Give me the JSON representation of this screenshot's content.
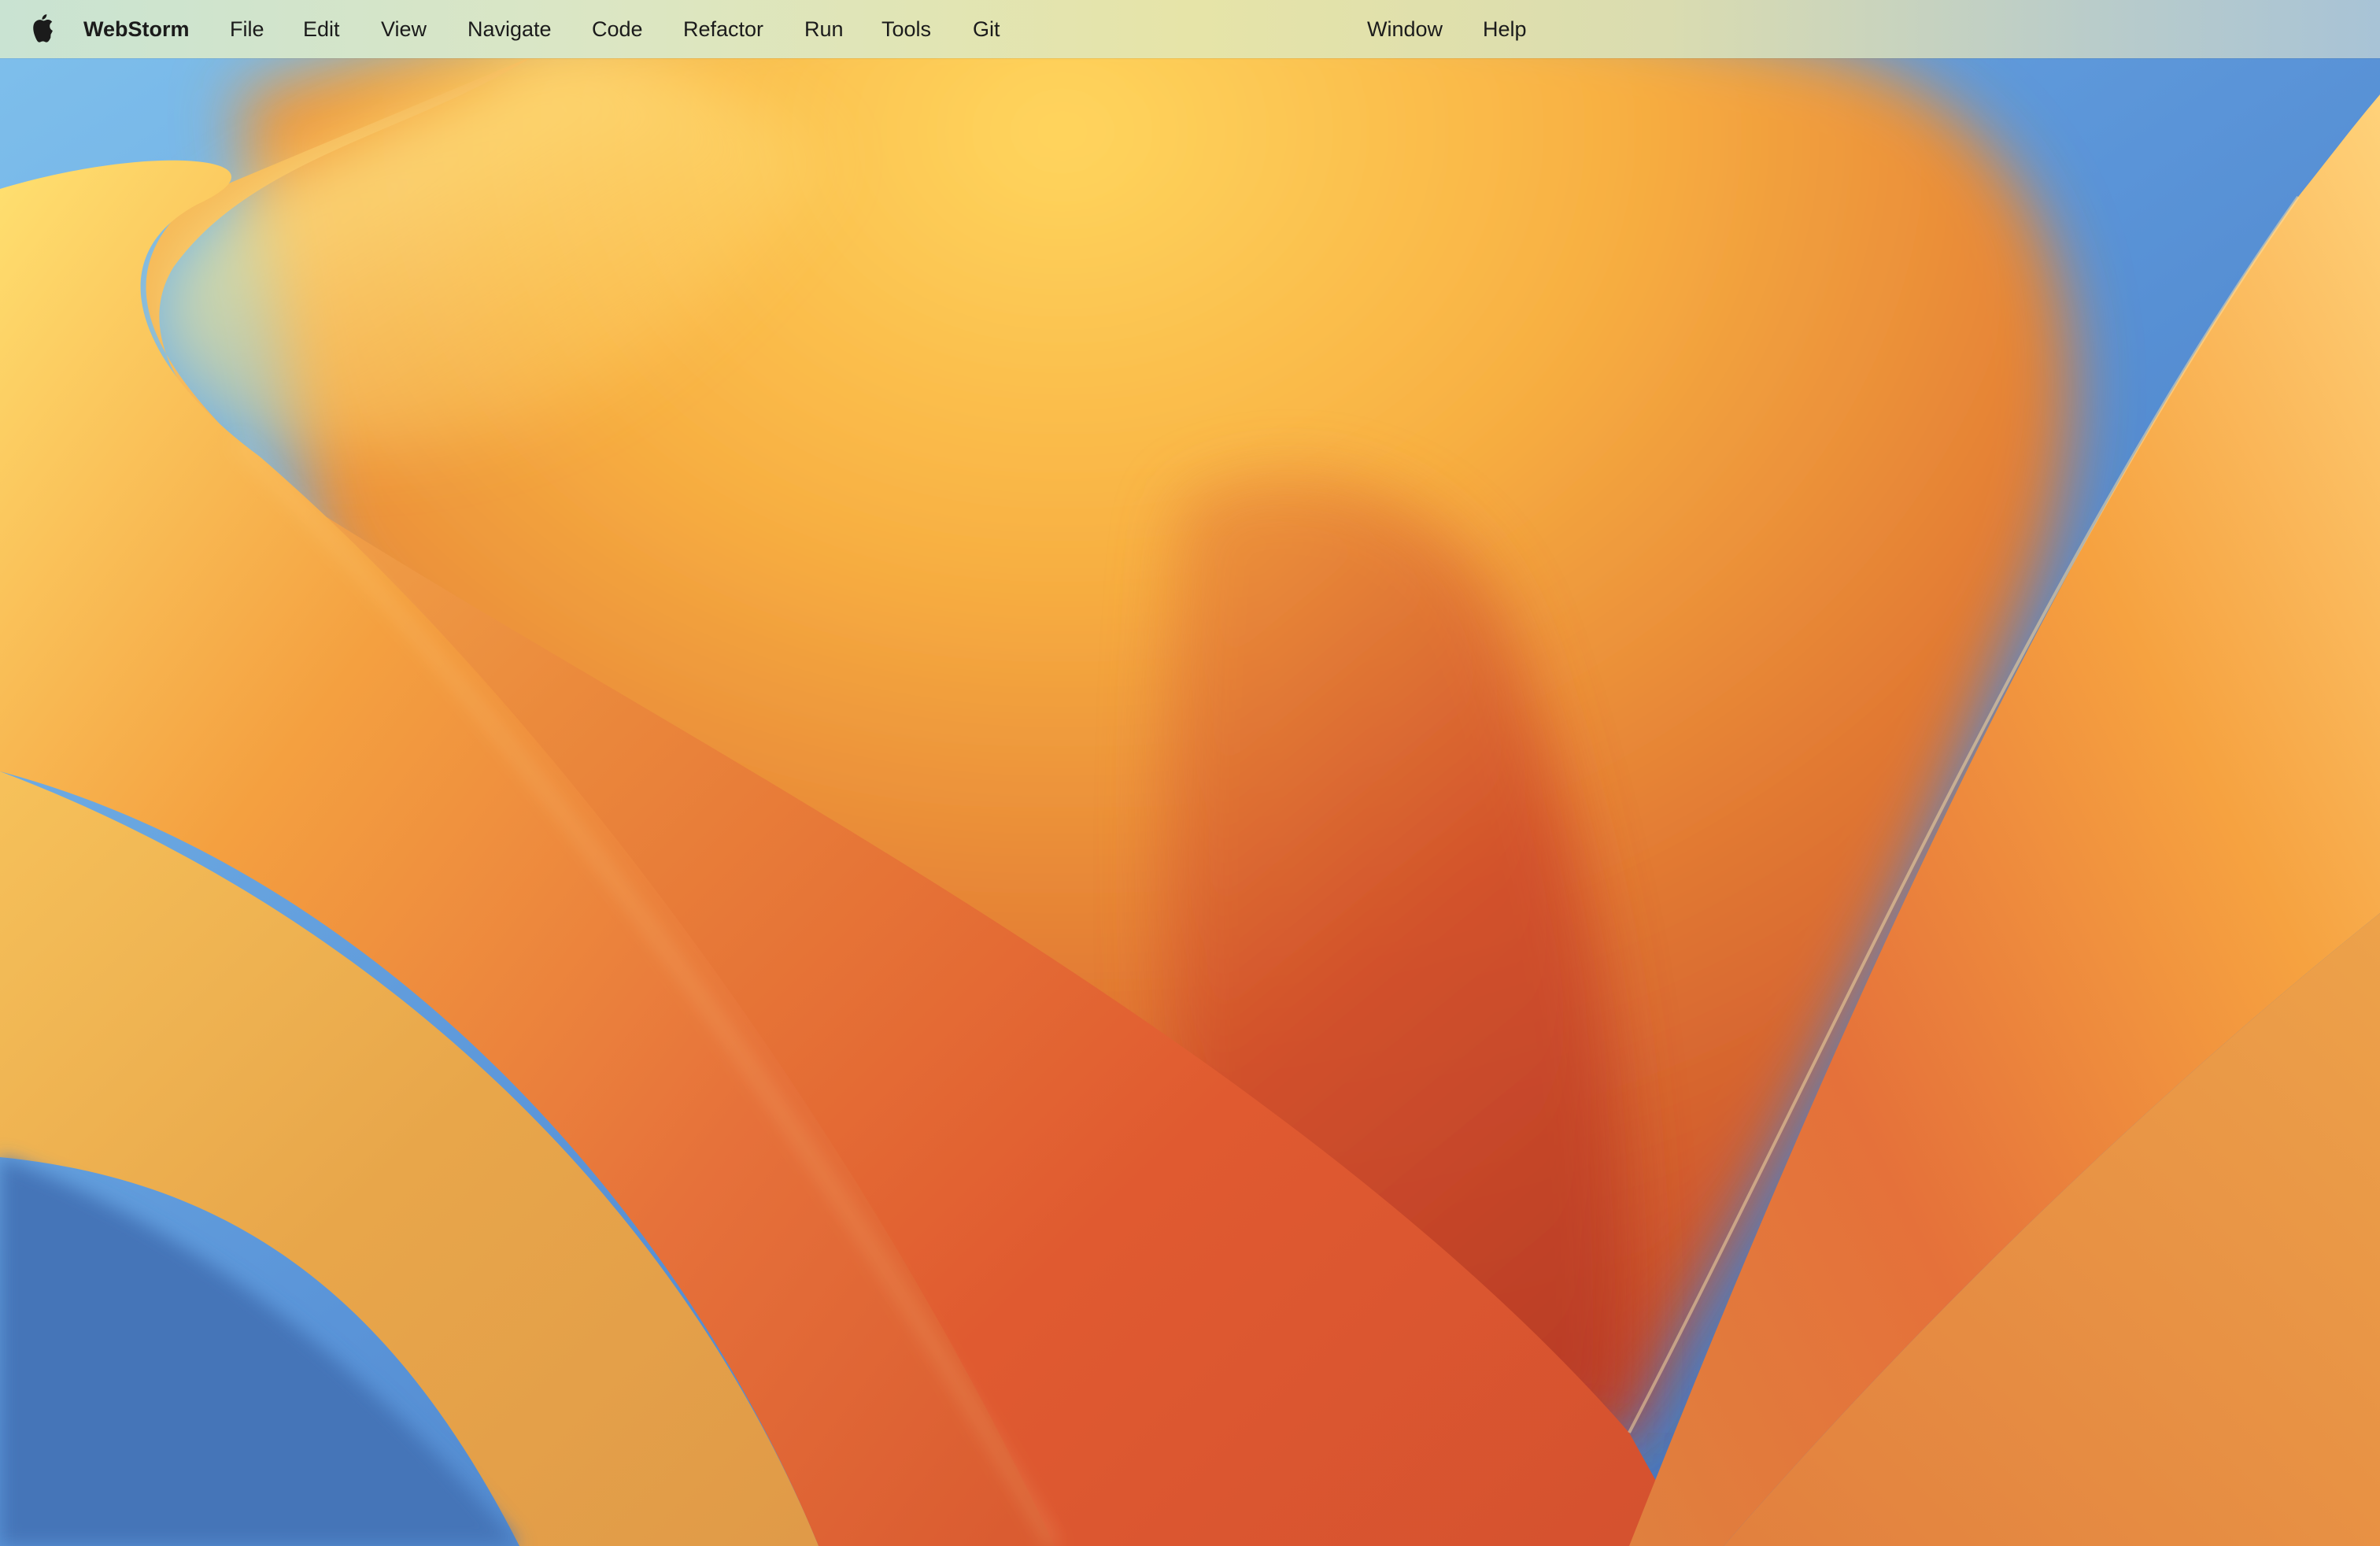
{
  "menubar": {
    "apple_icon": "apple-icon",
    "app_name": "WebStorm",
    "items": [
      {
        "id": "file",
        "label": "File"
      },
      {
        "id": "edit",
        "label": "Edit"
      },
      {
        "id": "view",
        "label": "View"
      },
      {
        "id": "navigate",
        "label": "Navigate"
      },
      {
        "id": "code",
        "label": "Code"
      },
      {
        "id": "refactor",
        "label": "Refactor"
      },
      {
        "id": "run",
        "label": "Run"
      },
      {
        "id": "tools",
        "label": "Tools"
      },
      {
        "id": "git",
        "label": "Git"
      },
      {
        "id": "window",
        "label": "Window"
      },
      {
        "id": "help",
        "label": "Help"
      }
    ]
  },
  "wallpaper": {
    "colors": {
      "sky_blue": "#5a94d8",
      "yellow": "#ffd862",
      "orange": "#f3a13e",
      "deep_orange": "#e0652e",
      "red": "#c0402a"
    }
  }
}
